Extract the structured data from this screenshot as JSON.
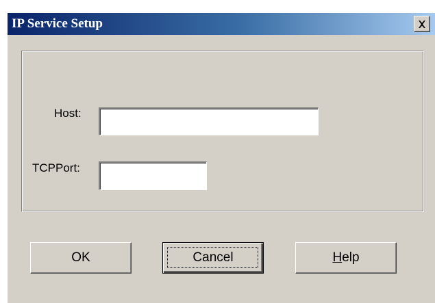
{
  "window": {
    "title": "IP Service Setup"
  },
  "titlebar": {
    "close_icon": "close-x-icon"
  },
  "form": {
    "host_label": "Host:",
    "host_value": "",
    "port_label": "TCPPort:",
    "port_value": ""
  },
  "buttons": {
    "ok_label": "OK",
    "cancel_label": "Cancel",
    "help_label": "Help",
    "default_button": "Cancel"
  },
  "colors": {
    "titlebar_start": "#0a246a",
    "titlebar_end": "#a6caf0",
    "face": "#d4d0c8"
  }
}
